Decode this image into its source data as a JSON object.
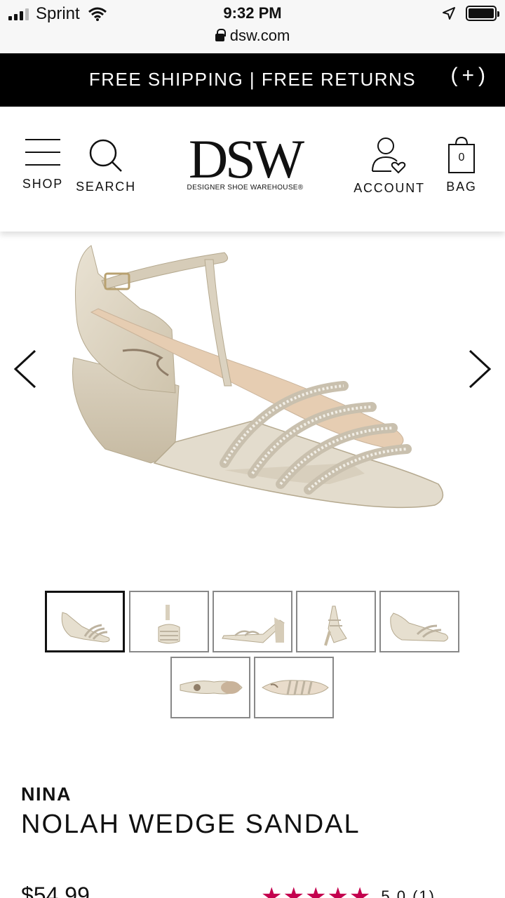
{
  "status_bar": {
    "carrier": "Sprint",
    "time": "9:32 PM",
    "url": "dsw.com"
  },
  "promo": {
    "text": "FREE SHIPPING | FREE RETURNS",
    "expand_label": "(+)"
  },
  "header": {
    "shop_label": "SHOP",
    "search_label": "SEARCH",
    "logo_text": "DSW",
    "logo_tagline": "DESIGNER SHOE WAREHOUSE®",
    "account_label": "ACCOUNT",
    "bag_label": "BAG",
    "bag_count": "0"
  },
  "gallery": {
    "thumbnail_count": 7,
    "selected_index": 0
  },
  "product": {
    "brand": "NINA",
    "name": "NOLAH WEDGE SANDAL",
    "price": "$54.99",
    "rating_stars": 5,
    "rating_text": "5.0 (1)"
  },
  "colors": {
    "promo_bg": "#000000",
    "star_color": "#c4004e",
    "accent": "#111111"
  }
}
